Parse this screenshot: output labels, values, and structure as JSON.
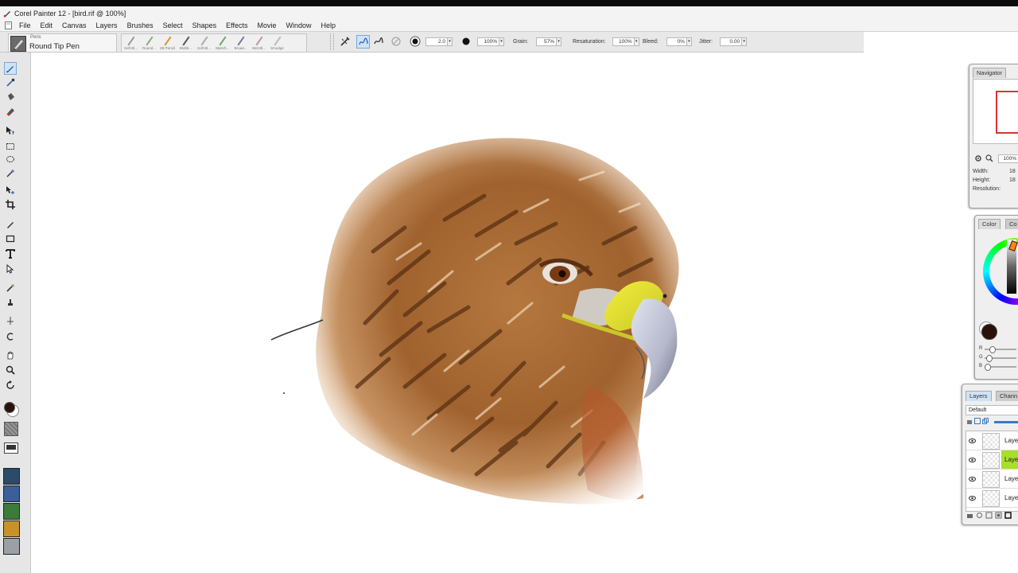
{
  "window": {
    "title": "Corel Painter 12 - [bird.rif @ 100%]"
  },
  "menu": [
    "File",
    "Edit",
    "Canvas",
    "Layers",
    "Brushes",
    "Select",
    "Shapes",
    "Effects",
    "Movie",
    "Window",
    "Help"
  ],
  "brush_selector": {
    "category": "Pens",
    "variant": "Round Tip Pen"
  },
  "recent_brushes": [
    {
      "label": "Soft Bl..."
    },
    {
      "label": "Round..."
    },
    {
      "label": "2B Pencil"
    },
    {
      "label": "Blobb..."
    },
    {
      "label": "Soft Bl..."
    },
    {
      "label": "Sketch..."
    },
    {
      "label": "Broad..."
    },
    {
      "label": "Wet Bl..."
    },
    {
      "label": "Smudge"
    }
  ],
  "property_bar": {
    "size_value": "2.0",
    "opacity_value": "100%",
    "grain_label": "Grain:",
    "grain_value": "57%",
    "resaturation_label": "Resaturation:",
    "resaturation_value": "100%",
    "bleed_label": "Bleed:",
    "bleed_value": "0%",
    "jitter_label": "Jitter:",
    "jitter_value": "0.00"
  },
  "toolbox": {
    "main_color": "#2a1209",
    "tools": [
      "brush-tool",
      "dropper-tool",
      "paint-bucket-tool",
      "eraser-tool",
      "layer-adjuster-tool",
      "rectangular-selection-tool",
      "lasso-tool",
      "magic-wand-tool",
      "transform-tool",
      "crop-tool",
      "pen-tool",
      "rectangle-shape-tool",
      "text-tool",
      "shape-selection-tool",
      "cloner-tool",
      "rubber-stamp-tool",
      "dodge-tool",
      "mirror-tool",
      "divine-proportion-tool",
      "grabber-tool",
      "magnifier-tool",
      "rotate-page-tool"
    ]
  },
  "navigator": {
    "tab": "Navigator",
    "zoom": "100%",
    "width_label": "Width:",
    "width_value": "18",
    "height_label": "Height:",
    "height_value": "18",
    "resolution_label": "Resolution:"
  },
  "color_panel": {
    "tab": "Color",
    "tab2": "Co",
    "current_color": "#2a1209",
    "r_label": "R",
    "g_label": "G",
    "b_label": "B"
  },
  "layers_panel": {
    "tab": "Layers",
    "tab2": "Chann",
    "composite_method": "Default",
    "selected_color": "#a7df2b",
    "layers": [
      {
        "name": "Layer",
        "selected": false
      },
      {
        "name": "Layer",
        "selected": true
      },
      {
        "name": "Layer",
        "selected": false
      },
      {
        "name": "Layer",
        "selected": false
      }
    ]
  }
}
